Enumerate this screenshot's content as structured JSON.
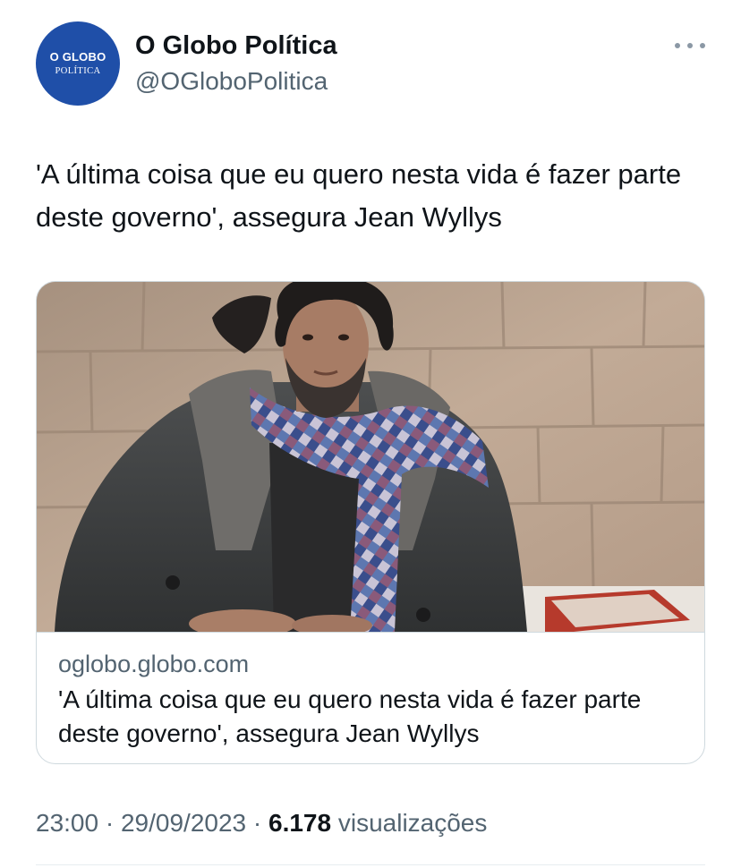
{
  "account": {
    "avatar_line1": "O GLOBO",
    "avatar_line2": "POLÍTICA",
    "display_name": "O Globo Política",
    "handle": "@OGloboPolitica"
  },
  "more_menu_icon": "more-horizontal-icon",
  "tweet": {
    "text": "'A última coisa que eu quero nesta vida é fazer parte deste governo', assegura Jean Wyllys"
  },
  "link_card": {
    "image_alt": "Foto de homem de cachecol colorido e casaco escuro diante de parede de pedra",
    "domain": "oglobo.globo.com",
    "title": "'A última coisa que eu quero nesta vida é fazer parte deste governo', assegura Jean Wyllys"
  },
  "footer": {
    "time": "23:00",
    "separator": "·",
    "date": "29/09/2023",
    "views_count": "6.178",
    "views_label": "visualizações"
  },
  "colors": {
    "avatar_bg": "#1f4fa8",
    "secondary_text": "#536471",
    "primary_text": "#0f1419",
    "border": "#cfd9de"
  }
}
